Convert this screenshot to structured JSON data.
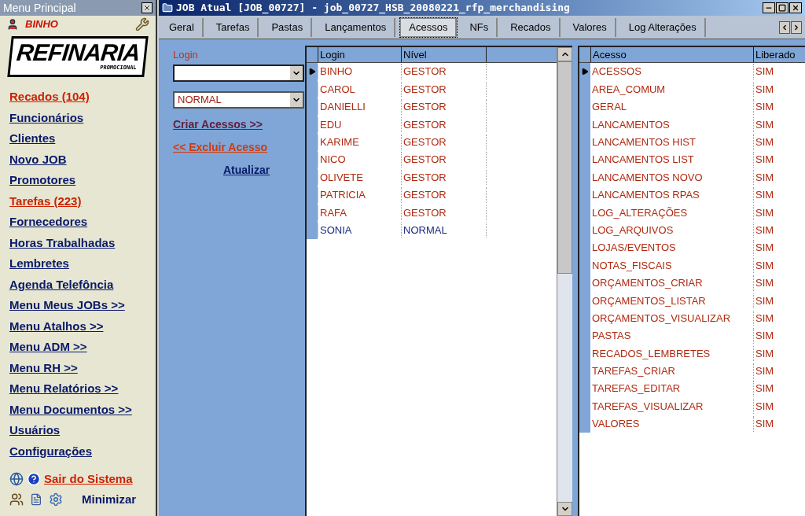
{
  "sidebar": {
    "title": "Menu Principal",
    "user": "BINHO",
    "logo": {
      "name": "REFINARIA",
      "tagline": "PROMOCIONAL"
    },
    "items": [
      {
        "label": "Recados (104)",
        "color": "#cc2200"
      },
      {
        "label": "Funcionários",
        "color": "#0a1a6a"
      },
      {
        "label": "Clientes",
        "color": "#0a1a6a"
      },
      {
        "label": "Novo JOB",
        "color": "#0a1a6a"
      },
      {
        "label": "Promotores",
        "color": "#0a1a6a"
      },
      {
        "label": "Tarefas (223)",
        "color": "#cc2200"
      },
      {
        "label": "Fornecedores",
        "color": "#0a1a6a"
      },
      {
        "label": "Horas Trabalhadas",
        "color": "#0a1a6a"
      },
      {
        "label": "Lembretes",
        "color": "#0a1a6a"
      },
      {
        "label": "Agenda Telefôncia",
        "color": "#0a1a6a"
      },
      {
        "label": "Menu Meus JOBs >>",
        "color": "#0a1a6a"
      },
      {
        "label": "Menu Atalhos >>",
        "color": "#0a1a6a"
      },
      {
        "label": "Menu ADM >>",
        "color": "#0a1a6a"
      },
      {
        "label": "Menu RH >>",
        "color": "#0a1a6a"
      },
      {
        "label": "Menu Relatórios >>",
        "color": "#0a1a6a"
      },
      {
        "label": "Menu Documentos >>",
        "color": "#0a1a6a"
      },
      {
        "label": "Usuários",
        "color": "#0a1a6a"
      },
      {
        "label": "Configurações",
        "color": "#0a1a6a"
      }
    ],
    "exit": "Sair do Sistema",
    "minimize": "Minimizar"
  },
  "window": {
    "title": "JOB Atual [JOB_00727] - job_00727_HSB_20080221_rfp_merchandising"
  },
  "tabs": [
    {
      "label": "Geral",
      "selected": false
    },
    {
      "label": "Tarefas",
      "selected": false
    },
    {
      "label": "Pastas",
      "selected": false
    },
    {
      "label": "Lançamentos",
      "selected": false
    },
    {
      "label": "Acessos",
      "selected": true
    },
    {
      "label": "NFs",
      "selected": false
    },
    {
      "label": "Recados",
      "selected": false
    },
    {
      "label": "Valores",
      "selected": false
    },
    {
      "label": "Log Alterações",
      "selected": false
    }
  ],
  "form": {
    "login_label": "Login",
    "level_value": "NORMAL",
    "create": "Criar Acessos >>",
    "delete": "<< Excluir Acesso",
    "refresh": "Atualizar"
  },
  "users": {
    "columns": [
      "Login",
      "Nível"
    ],
    "rows": [
      {
        "login": "BINHO",
        "level": "GESTOR",
        "color": "#b02a10",
        "selected": true
      },
      {
        "login": "CAROL",
        "level": "GESTOR",
        "color": "#b02a10",
        "selected": false
      },
      {
        "login": "DANIELLI",
        "level": "GESTOR",
        "color": "#b02a10",
        "selected": false
      },
      {
        "login": "EDU",
        "level": "GESTOR",
        "color": "#b02a10",
        "selected": false
      },
      {
        "login": "KARIME",
        "level": "GESTOR",
        "color": "#b02a10",
        "selected": false
      },
      {
        "login": "NICO",
        "level": "GESTOR",
        "color": "#b02a10",
        "selected": false
      },
      {
        "login": "OLIVETE",
        "level": "GESTOR",
        "color": "#b02a10",
        "selected": false
      },
      {
        "login": "PATRICIA",
        "level": "GESTOR",
        "color": "#b02a10",
        "selected": false
      },
      {
        "login": "RAFA",
        "level": "GESTOR",
        "color": "#b02a10",
        "selected": false
      },
      {
        "login": "SONIA",
        "level": "NORMAL",
        "color": "#1a2a80",
        "selected": false
      }
    ]
  },
  "access": {
    "columns": [
      "Acesso",
      "Liberado"
    ],
    "rows": [
      {
        "name": "ACESSOS",
        "allowed": "SIM",
        "selected": true
      },
      {
        "name": "AREA_COMUM",
        "allowed": "SIM",
        "selected": false
      },
      {
        "name": "GERAL",
        "allowed": "SIM",
        "selected": false
      },
      {
        "name": "LANCAMENTOS",
        "allowed": "SIM",
        "selected": false
      },
      {
        "name": "LANCAMENTOS HIST",
        "allowed": "SIM",
        "selected": false
      },
      {
        "name": "LANCAMENTOS LIST",
        "allowed": "SIM",
        "selected": false
      },
      {
        "name": "LANCAMENTOS NOVO",
        "allowed": "SIM",
        "selected": false
      },
      {
        "name": "LANCAMENTOS RPAS",
        "allowed": "SIM",
        "selected": false
      },
      {
        "name": "LOG_ALTERAÇÕES",
        "allowed": "SIM",
        "selected": false
      },
      {
        "name": "LOG_ARQUIVOS",
        "allowed": "SIM",
        "selected": false
      },
      {
        "name": "LOJAS/EVENTOS",
        "allowed": "SIM",
        "selected": false
      },
      {
        "name": "NOTAS_FISCAIS",
        "allowed": "SIM",
        "selected": false
      },
      {
        "name": "ORÇAMENTOS_CRIAR",
        "allowed": "SIM",
        "selected": false
      },
      {
        "name": "ORÇAMENTOS_LISTAR",
        "allowed": "SIM",
        "selected": false
      },
      {
        "name": "ORÇAMENTOS_VISUALIZAR",
        "allowed": "SIM",
        "selected": false
      },
      {
        "name": "PASTAS",
        "allowed": "SIM",
        "selected": false
      },
      {
        "name": "RECADOS_LEMBRETES",
        "allowed": "SIM",
        "selected": false
      },
      {
        "name": "TAREFAS_CRIAR",
        "allowed": "SIM",
        "selected": false
      },
      {
        "name": "TAREFAS_EDITAR",
        "allowed": "SIM",
        "selected": false
      },
      {
        "name": "TAREFAS_VISUALIZAR",
        "allowed": "SIM",
        "selected": false
      },
      {
        "name": "VALORES",
        "allowed": "SIM",
        "selected": false
      }
    ]
  }
}
